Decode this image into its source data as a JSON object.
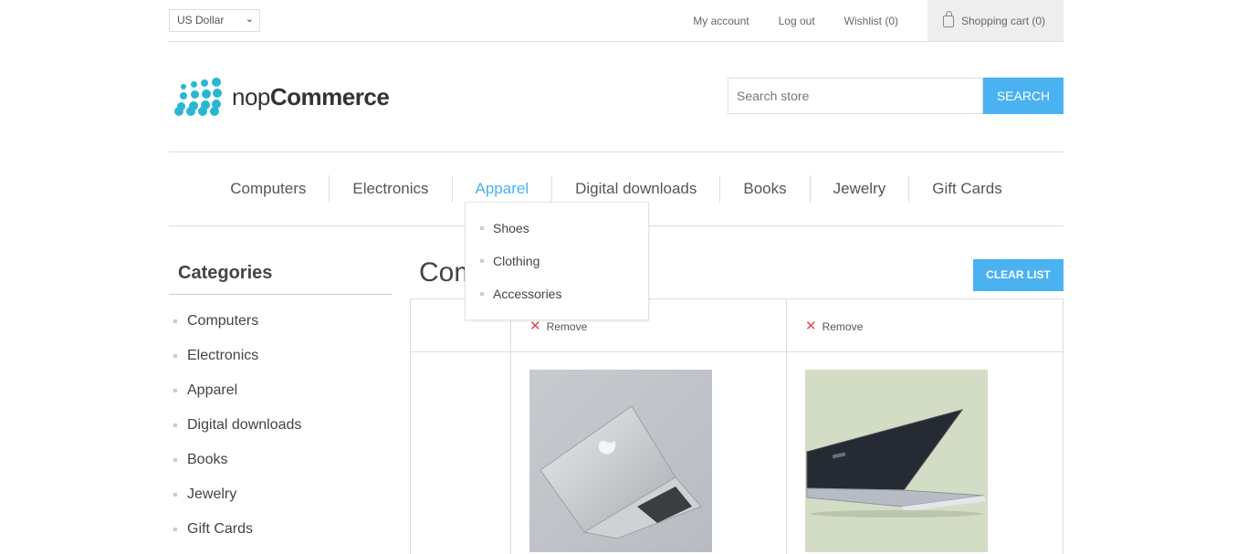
{
  "header": {
    "currency": "US Dollar",
    "links": {
      "my_account": "My account",
      "log_out": "Log out",
      "wishlist": "Wishlist (0)",
      "cart": "Shopping cart (0)"
    }
  },
  "logo": {
    "text_light": "nop",
    "text_bold": "Commerce"
  },
  "search": {
    "placeholder": "Search store",
    "button": "SEARCH"
  },
  "menu": {
    "items": [
      "Computers",
      "Electronics",
      "Apparel",
      "Digital downloads",
      "Books",
      "Jewelry",
      "Gift Cards"
    ],
    "active": "Apparel",
    "submenu": [
      "Shoes",
      "Clothing",
      "Accessories"
    ]
  },
  "sidebar": {
    "title": "Categories",
    "items": [
      "Computers",
      "Electronics",
      "Apparel",
      "Digital downloads",
      "Books",
      "Jewelry",
      "Gift Cards"
    ]
  },
  "main": {
    "title": "Com",
    "clear_button": "CLEAR LIST",
    "remove_label": "Remove",
    "remove_icon": "close-icon"
  },
  "colors": {
    "accent": "#4ab2f1",
    "remove_x": "#e4444f",
    "logo_dots": "#29b6d6"
  }
}
